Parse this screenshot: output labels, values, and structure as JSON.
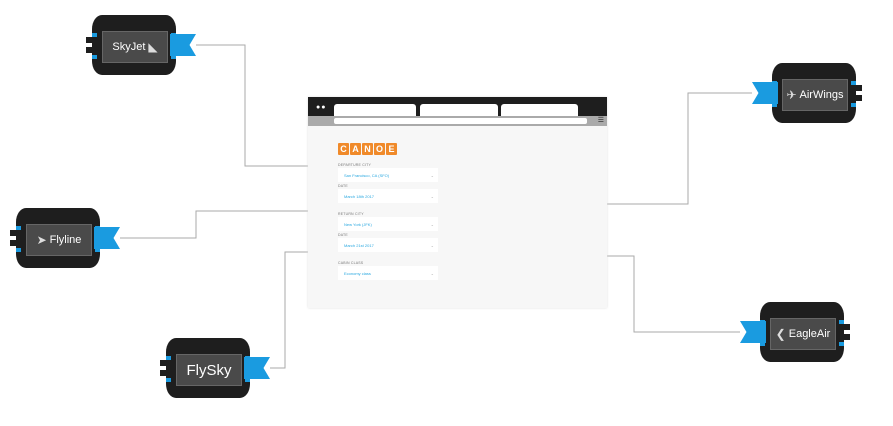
{
  "nodes": [
    {
      "name": "SkyJet",
      "icon": "plane-tail-icon",
      "glyph": "◣"
    },
    {
      "name": "Flyline",
      "icon": "bird-icon",
      "glyph": "➤"
    },
    {
      "name": "FlySky",
      "icon": "none",
      "glyph": ""
    },
    {
      "name": "AirWings",
      "icon": "winged-globe-icon",
      "glyph": "✈"
    },
    {
      "name": "EagleAir",
      "icon": "eagle-icon",
      "glyph": "❮"
    }
  ],
  "browser": {
    "logo": [
      "C",
      "A",
      "N",
      "O",
      "E"
    ],
    "fields": [
      {
        "label": "DEPARTURE CITY",
        "value": "San Francisco, CA (SFO)"
      },
      {
        "label": "DATE",
        "value": "March 18th 2017"
      },
      {
        "label": "RETURN CITY",
        "value": "New York (JFK)"
      },
      {
        "label": "DATE",
        "value": "March 21st 2017"
      },
      {
        "label": "CABIN CLASS",
        "value": "Economy class"
      }
    ]
  },
  "colors": {
    "accent": "#1a9be0",
    "logo": "#f08a2a",
    "node": "#1e1e1e"
  }
}
